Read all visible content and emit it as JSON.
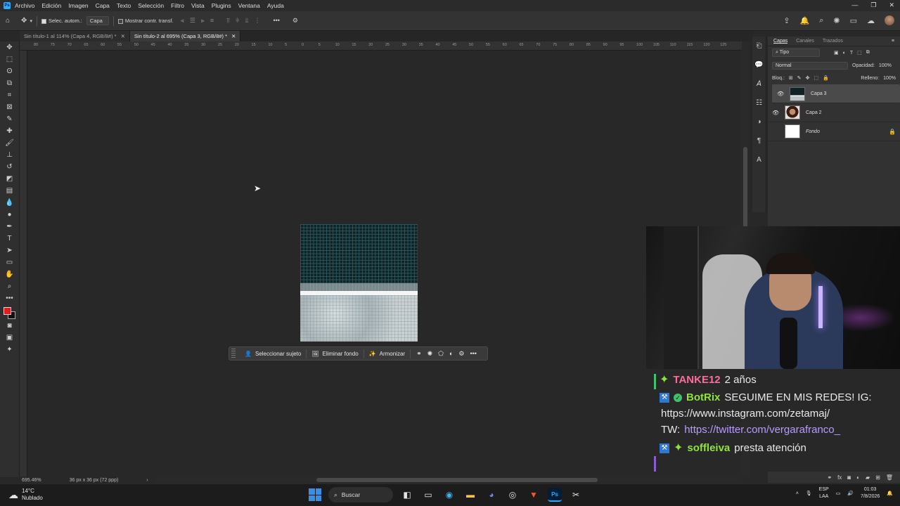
{
  "menubar": {
    "logo": "Ps",
    "items": [
      "Archivo",
      "Edición",
      "Imagen",
      "Capa",
      "Texto",
      "Selección",
      "Filtro",
      "Vista",
      "Plugins",
      "Ventana",
      "Ayuda"
    ]
  },
  "options": {
    "auto_select_label": "Selec. autom.:",
    "auto_select_value": "Capa",
    "transform_label": "Mostrar contr. transf."
  },
  "tabs": [
    {
      "label": "Sin título-1 al 114% (Capa 4, RGB/8#) *"
    },
    {
      "label": "Sin título-2 al 695% (Capa 3, RGB/8#) *"
    }
  ],
  "ruler_ticks": [
    "80",
    "75",
    "70",
    "65",
    "60",
    "55",
    "50",
    "45",
    "40",
    "35",
    "30",
    "25",
    "20",
    "15",
    "10",
    "5",
    "0",
    "5",
    "10",
    "15",
    "20",
    "25",
    "30",
    "35",
    "40",
    "45",
    "50",
    "55",
    "60",
    "65",
    "70",
    "75",
    "80",
    "85",
    "90",
    "95",
    "100",
    "105",
    "110",
    "115",
    "120",
    "125"
  ],
  "context_bar": {
    "select_subject": "Seleccionar sujeto",
    "remove_bg": "Eliminar fondo",
    "harmonize": "Armonizar"
  },
  "status": {
    "zoom": "695.46%",
    "doc_size": "36 px x 36 px (72 ppp)"
  },
  "layers_panel": {
    "tabs": [
      "Capas",
      "Canales",
      "Trazados"
    ],
    "filter": "Tipo",
    "blend": "Normal",
    "opacity_label": "Opacidad:",
    "opacity_value": "100%",
    "lock_label": "Bloq.:",
    "fill_label": "Relleno:",
    "fill_value": "100%",
    "layers": [
      {
        "name": "Capa 3"
      },
      {
        "name": "Capa 2"
      },
      {
        "name": "Fondo"
      }
    ]
  },
  "chat": {
    "line1_user": "TANKE12",
    "line1_msg": "2 años",
    "line2_user": "BotRix",
    "line2_msg": "SEGUIME EN MIS REDES! IG:",
    "line3": "https://www.instagram.com/zetamaj/",
    "line4_prefix": "TW:",
    "line4_link": "https://twitter.com/vergarafranco_",
    "line5_user": "soffleiva",
    "line5_msg": "presta atención"
  },
  "taskbar": {
    "temp": "14°C",
    "weather": "Nublado",
    "search": "Buscar",
    "lang1": "ESP",
    "lang2": "LAA",
    "time": "01:03",
    "date": "7/8/2026"
  },
  "colors": {
    "foreground": "#e21b1b",
    "background": "#111111",
    "accent": "#31a8ff"
  }
}
